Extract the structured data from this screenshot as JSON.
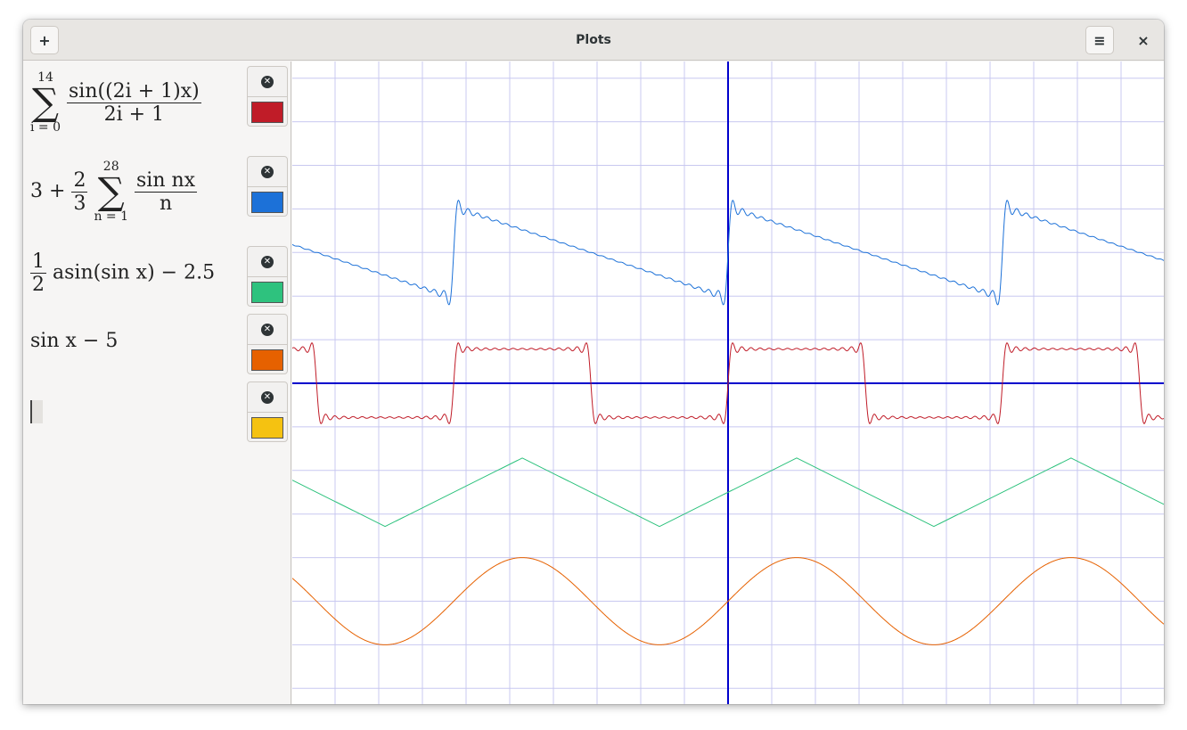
{
  "window": {
    "title": "Plots"
  },
  "header": {
    "add_label": "+",
    "menu_label": "≡",
    "close_label": "×"
  },
  "formulas": [
    {
      "id": "f1",
      "color": "#c01c28",
      "sum_upper": "14",
      "sum_lower": "i = 0",
      "numerator": "sin((2i + 1)x)",
      "denominator": "2i + 1"
    },
    {
      "id": "f2",
      "color": "#1c71d8",
      "prefix": "3 +",
      "coef_num": "2",
      "coef_den": "3",
      "sum_upper": "28",
      "sum_lower": "n = 1",
      "numerator": "sin nx",
      "denominator": "n"
    },
    {
      "id": "f3",
      "color": "#2ec27e",
      "coef_num": "1",
      "coef_den": "2",
      "body": "asin(sin x) − 2.5"
    },
    {
      "id": "f4",
      "color": "#e66100",
      "body": "sin x − 5"
    },
    {
      "id": "f5",
      "color": "#f5c211",
      "body": ""
    }
  ],
  "remove_icon": "close-circle-icon",
  "plot": {
    "axis_color": "#0000cc",
    "grid_color": "#c8c8f0"
  }
}
